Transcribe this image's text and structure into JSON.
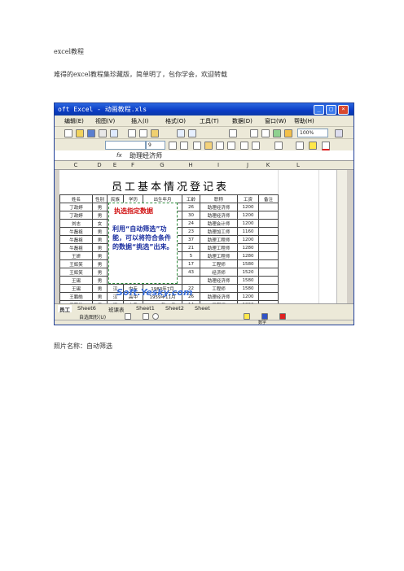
{
  "doc": {
    "line1": "excel教程",
    "line2": "难得的excel教程集珍藏版，简单明了，包你学会，欢迎转载",
    "caption": "照片名称：自动筛选"
  },
  "app": {
    "title": "oft Excel - 动画教程.xls",
    "menus": [
      "编辑(E)",
      "视图(V)",
      "插入(I)",
      "格式(O)",
      "工具(T)",
      "数据(D)",
      "窗口(W)",
      "帮助(H)"
    ],
    "zoom": "100%",
    "font_size": "9",
    "formula_label": "fx",
    "formula_value": "助理经济师"
  },
  "columns": [
    "C",
    "D",
    "E",
    "F",
    "G",
    "H",
    "I",
    "J",
    "K",
    "L"
  ],
  "sheet": {
    "title": "员工基本情况登记表",
    "headers": [
      "姓名",
      "性别",
      "民族",
      "学历",
      "出生年月",
      "工龄",
      "职称",
      "工资",
      "备注"
    ],
    "rows": [
      [
        "丁政婷",
        "男",
        "汉",
        "大专",
        "1960年12月",
        "26",
        "助理经济师",
        "1200",
        ""
      ],
      [
        "丁政婷",
        "男",
        "",
        "",
        "月",
        "30",
        "助理经济师",
        "1200",
        ""
      ],
      [
        "刘志",
        "女",
        "",
        "",
        "月",
        "24",
        "助理会计师",
        "1200",
        ""
      ],
      [
        "牛磊祖",
        "男",
        "",
        "",
        "月",
        "23",
        "助理加工师",
        "1160",
        ""
      ],
      [
        "牛磊祖",
        "男",
        "",
        "",
        "月",
        "37",
        "助理工程师",
        "1200",
        ""
      ],
      [
        "牛磊祖",
        "男",
        "",
        "",
        "月",
        "21",
        "助理工程师",
        "1280",
        ""
      ],
      [
        "王妍",
        "男",
        "",
        "",
        "月",
        "5",
        "助理工程师",
        "1280",
        ""
      ],
      [
        "王辉笑",
        "男",
        "",
        "",
        "月",
        "17",
        "工程师",
        "1580",
        ""
      ],
      [
        "王辉笑",
        "男",
        "",
        "",
        "月",
        "43",
        "经济师",
        "1520",
        ""
      ],
      [
        "王锡",
        "男",
        "",
        "",
        "",
        "",
        "助理经济师",
        "1580",
        ""
      ],
      [
        "王锡",
        "男",
        "汉",
        "中专",
        "1983年7月",
        "22",
        "工程师",
        "1580",
        ""
      ],
      [
        "王鹏皓",
        "男",
        "汉",
        "高中",
        "1959年11月",
        "26",
        "助理经济师",
        "1200",
        ""
      ],
      [
        "王鹏皓",
        "男",
        "汉",
        "大专",
        "1971年12月",
        "14",
        "工程师",
        "1200",
        ""
      ],
      [
        "卢关东",
        "男",
        "汉",
        "大专",
        "1983年7月",
        "23",
        "经济师",
        "1500",
        ""
      ],
      [
        "卢关东",
        "男",
        "汉",
        "大专",
        "1948年8月",
        "35",
        "高级工程师",
        "1800",
        ""
      ],
      [
        "卢斯",
        "女",
        "汉",
        "中专",
        "1987年4月",
        "19",
        "助理工程师",
        "1280",
        ""
      ]
    ]
  },
  "annotation": {
    "heading": "执选指定数据",
    "body": "利用“自动筛选”功能，可以将符合条件的数据“挑选”出来。"
  },
  "watermark": "Soft.Yesky.com",
  "tabs": [
    "员工",
    "Sheet6",
    "班课表",
    "Sheet1",
    "Sheet2",
    "Sheet"
  ],
  "drawing_label": "自选图形(U)",
  "status": "数字"
}
